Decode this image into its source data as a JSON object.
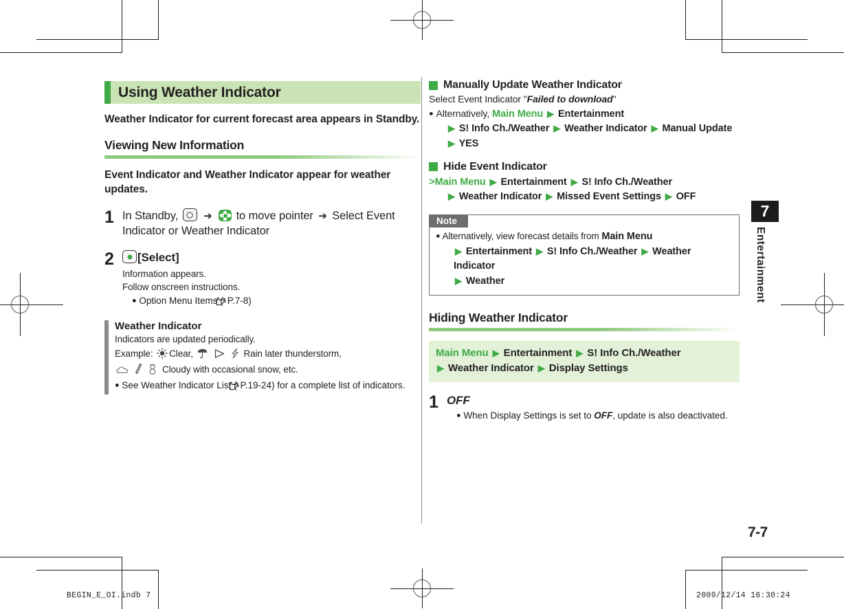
{
  "left": {
    "title_bar": "Using Weather Indicator",
    "lead": "Weather Indicator for current forecast area appears in Standby.",
    "section_heading": "Viewing New Information",
    "section_lead": "Event Indicator and Weather Indicator appear for weather updates.",
    "steps": [
      {
        "num": "1",
        "text_before_key1": "In Standby,",
        "arrow1": "➔",
        "text_mid": "to move pointer",
        "arrow2": "➔",
        "text_after": "Select Event Indicator or Weather Indicator"
      },
      {
        "num": "2",
        "label": "[Select]",
        "sub1": "Information appears.",
        "sub2": "Follow onscreen instructions.",
        "bullet": "Option Menu Items (",
        "bullet_ref": "P.7-8",
        "bullet_tail": ")"
      }
    ],
    "infobox": {
      "title": "Weather Indicator",
      "line1": "Indicators are updated periodically.",
      "example_label": "Example:",
      "example_clear": "Clear,",
      "example_rain": "Rain later thunderstorm,",
      "example_cloudy": "Cloudy with occasional snow, etc.",
      "bullet_a": "See Weather Indicator List (",
      "bullet_ref": "P.19-24",
      "bullet_b": ") for a complete list of indicators."
    }
  },
  "right": {
    "block1": {
      "heading": "Manually Update Weather Indicator",
      "line1_a": "Select Event Indicator \"",
      "line1_em": "Failed to download",
      "line1_b": "\"",
      "bullet_prefix": "Alternatively,",
      "nav": [
        "Main Menu",
        "Entertainment",
        "S! Info Ch./Weather",
        "Weather Indicator",
        "Manual Update",
        "YES"
      ]
    },
    "block2": {
      "heading": "Hide Event Indicator",
      "nav": [
        "Main Menu",
        "Entertainment",
        "S! Info Ch./Weather",
        "Weather Indicator",
        "Missed Event Settings",
        "OFF"
      ]
    },
    "note": {
      "tab": "Note",
      "bullet_text": "Alternatively, view forecast details from",
      "nav": [
        "Main Menu",
        "Entertainment",
        "S! Info Ch./Weather",
        "Weather Indicator",
        "Weather"
      ]
    },
    "section2": {
      "heading": "Hiding Weather Indicator",
      "nav": [
        "Main Menu",
        "Entertainment",
        "S! Info Ch./Weather",
        "Weather Indicator",
        "Display Settings"
      ],
      "step": {
        "num": "1",
        "label": "OFF",
        "bullet_a": "When Display Settings is set to ",
        "bullet_em": "OFF",
        "bullet_b": ", update is also deactivated."
      }
    }
  },
  "chapter": {
    "number": "7",
    "label": "Entertainment"
  },
  "page_number": "7-7",
  "footer": {
    "left": "BEGIN_E_OI.indb    7",
    "right": "2009/12/14    16:30:24"
  },
  "colors": {
    "accent_green": "#3faa46",
    "title_bar_bg": "#c9e3b4",
    "nav_panel_bg": "#e2f1d8",
    "note_tab_bg": "#6d6d6d",
    "gray_bar": "#8a8a8a"
  }
}
